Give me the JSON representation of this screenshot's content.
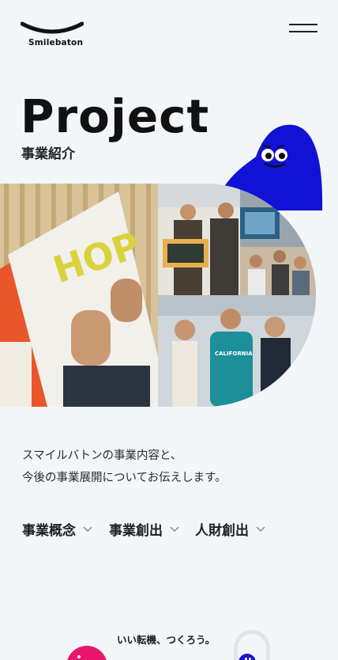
{
  "header": {
    "logo_text": "Smilebaton",
    "menu_icon": "hamburger-icon"
  },
  "hero": {
    "title": "Project",
    "subtitle": "事業紹介"
  },
  "intro": {
    "line1": "スマイルバトンの事業内容と、",
    "line2": "今後の事業展開についてお伝えします。"
  },
  "nav": {
    "items": [
      {
        "label": "事業概念"
      },
      {
        "label": "事業創出"
      },
      {
        "label": "人財創出"
      }
    ]
  },
  "footer": {
    "tagline": "いい転機、つくろう。"
  },
  "colors": {
    "background": "#f2f6f9",
    "mascot_blue": "#1212d6",
    "accent_pink": "#e8176b",
    "text": "#1e1e1e"
  }
}
